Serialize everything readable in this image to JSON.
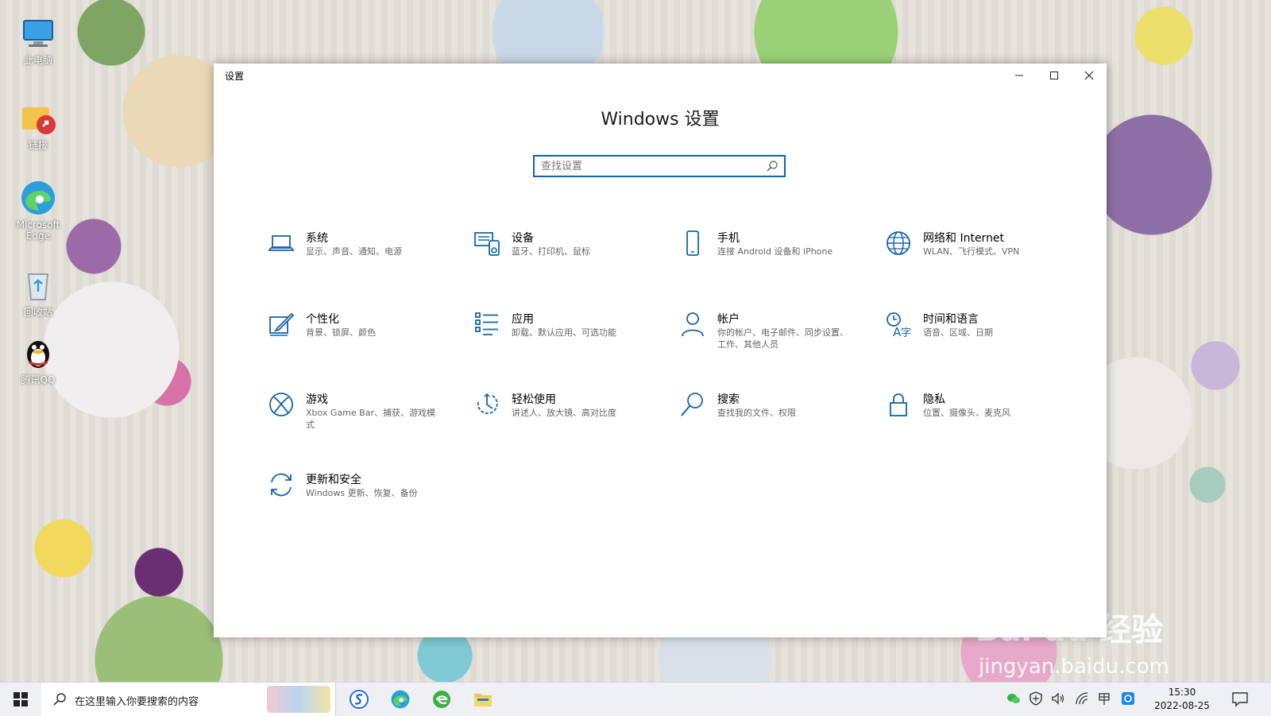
{
  "desktop": {
    "icons": [
      {
        "label": "此电脑",
        "icon": "computer-icon"
      },
      {
        "label": "链接",
        "icon": "folder-shortcut-icon"
      },
      {
        "label": "Microsoft Edge",
        "icon": "edge-icon"
      },
      {
        "label": "回收站",
        "icon": "recycle-bin-icon"
      },
      {
        "label": "腾讯QQ",
        "icon": "qq-penguin-icon"
      }
    ]
  },
  "window": {
    "title": "设置",
    "heading": "Windows 设置",
    "search_placeholder": "查找设置",
    "categories": [
      {
        "name": "系统",
        "desc": "显示、声音、通知、电源",
        "icon": "laptop-icon"
      },
      {
        "name": "设备",
        "desc": "蓝牙、打印机、鼠标",
        "icon": "devices-icon"
      },
      {
        "name": "手机",
        "desc": "连接 Android 设备和 iPhone",
        "icon": "phone-icon"
      },
      {
        "name": "网络和 Internet",
        "desc": "WLAN、飞行模式、VPN",
        "icon": "globe-icon"
      },
      {
        "name": "个性化",
        "desc": "背景、锁屏、颜色",
        "icon": "personalize-icon"
      },
      {
        "name": "应用",
        "desc": "卸载、默认应用、可选功能",
        "icon": "apps-list-icon"
      },
      {
        "name": "帐户",
        "desc": "你的帐户、电子邮件、同步设置、工作、其他人员",
        "icon": "person-icon"
      },
      {
        "name": "时间和语言",
        "desc": "语音、区域、日期",
        "icon": "time-language-icon"
      },
      {
        "name": "游戏",
        "desc": "Xbox Game Bar、捕获、游戏模式",
        "icon": "xbox-icon"
      },
      {
        "name": "轻松使用",
        "desc": "讲述人、放大镜、高对比度",
        "icon": "ease-of-access-icon"
      },
      {
        "name": "搜索",
        "desc": "查找我的文件、权限",
        "icon": "search-icon"
      },
      {
        "name": "隐私",
        "desc": "位置、摄像头、麦克风",
        "icon": "lock-icon"
      },
      {
        "name": "更新和安全",
        "desc": "Windows 更新、恢复、备份",
        "icon": "update-icon"
      }
    ]
  },
  "watermark": {
    "brand": "Bai du 经验",
    "url": "jingyan.baidu.com"
  },
  "taskbar": {
    "search_placeholder": "在这里输入你要搜索的内容",
    "apps": [
      "sogou-icon",
      "edge-icon",
      "browser-icon",
      "file-explorer-icon"
    ],
    "tray": [
      "wechat-icon",
      "security-shield-icon",
      "volume-icon",
      "network-icon",
      "ime-icon",
      "qq-tray-icon"
    ],
    "time": "15:30",
    "date": "2022-08-25"
  },
  "colors": {
    "accent": "#0a64b4",
    "icon_blue": "#1565a8"
  }
}
